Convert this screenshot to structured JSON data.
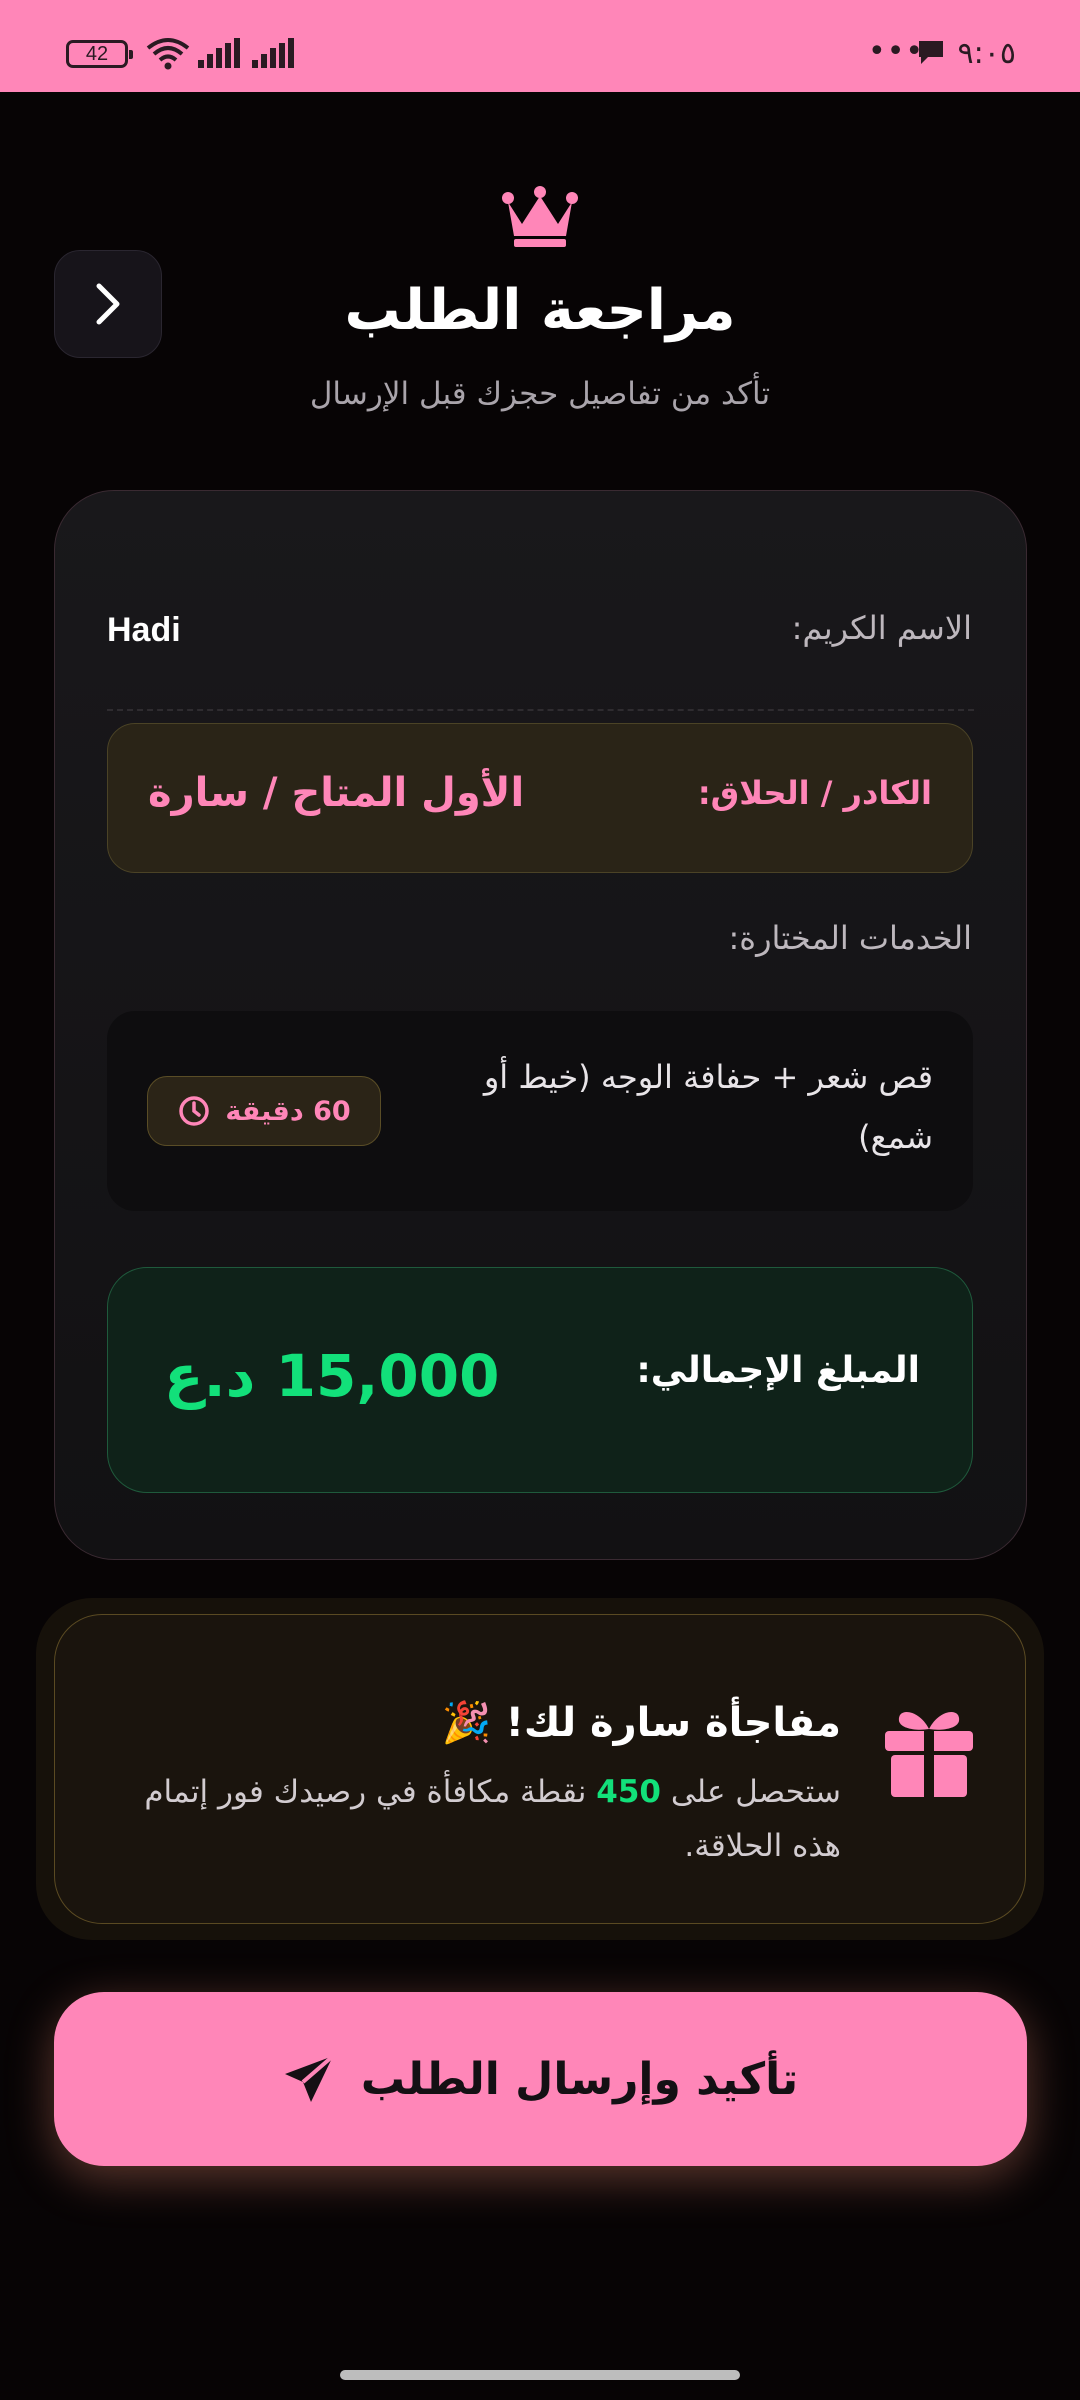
{
  "status_bar": {
    "battery": "42",
    "time": "٩:٠٥",
    "dots": "•••"
  },
  "header": {
    "title": "مراجعة الطلب",
    "subtitle": "تأكد من تفاصيل حجزك قبل الإرسال"
  },
  "summary": {
    "name_label": "الاسم الكريم:",
    "name_value": "Hadi",
    "barber_label": "الكادر / الحلاق:",
    "barber_value": "الأول المتاح / سارة",
    "services_label": "الخدمات المختارة:",
    "services": [
      {
        "name": "قص شعر + حفافة الوجه (خيط أو شمع)",
        "duration": "60 دقيقة"
      }
    ],
    "total_label": "المبلغ الإجمالي:",
    "total_value": "15,000 د.ع"
  },
  "reward": {
    "title": "مفاجأة سارة لك! 🎉",
    "text_before": "ستحصل على",
    "points": "450",
    "text_after": "نقطة مكافأة في رصيدك فور إتمام هذه الحلاقة."
  },
  "submit": {
    "label": "تأكيد وإرسال الطلب"
  },
  "colors": {
    "accent": "#ff86b8",
    "success": "#12e07a",
    "background": "#070405"
  },
  "icons": [
    "crown-icon",
    "chevron-right-icon",
    "clock-icon",
    "gift-icon",
    "send-icon",
    "wifi-icon",
    "signal-icon",
    "chat-icon"
  ]
}
